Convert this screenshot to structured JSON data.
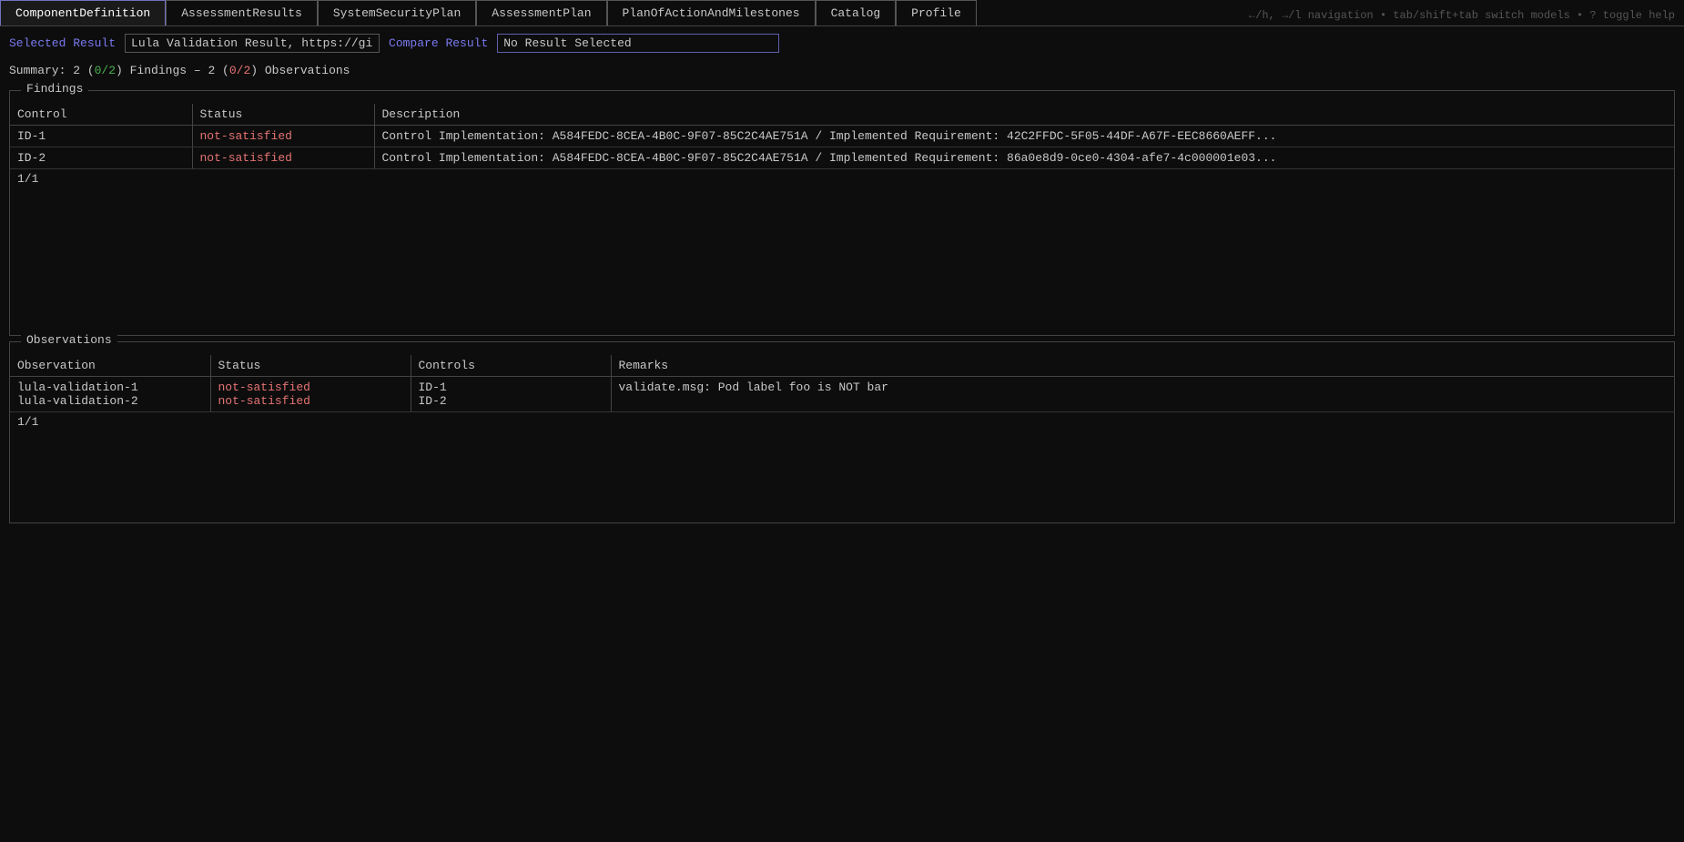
{
  "tabs": [
    {
      "id": "component-definition",
      "label": "ComponentDefinition",
      "active": false
    },
    {
      "id": "assessment-results",
      "label": "AssessmentResults",
      "active": true
    },
    {
      "id": "system-security-plan",
      "label": "SystemSecurityPlan",
      "active": false
    },
    {
      "id": "assessment-plan",
      "label": "AssessmentPlan",
      "active": false
    },
    {
      "id": "plan-of-action-and-milestones",
      "label": "PlanOfActionAndMilestones",
      "active": false
    },
    {
      "id": "catalog",
      "label": "Catalog",
      "active": false
    },
    {
      "id": "profile",
      "label": "Profile",
      "active": false
    }
  ],
  "help_text": "←/h, →/l navigation • tab/shift+tab switch models • ? toggle help",
  "selected_result": {
    "label": "Selected Result",
    "value": "Lula Validation Result, https://github...",
    "placeholder": "Lula Validation Result, https://github..."
  },
  "compare_result": {
    "label": "Compare Result",
    "value": "No Result Selected",
    "placeholder": "No Result Selected"
  },
  "summary": {
    "prefix": "Summary: 2 (",
    "green_part": "0/2",
    "middle": ") Findings – 2 (",
    "red_part": "0/2",
    "suffix": ") Observations"
  },
  "findings": {
    "section_label": "Findings",
    "columns": [
      "Control",
      "Status",
      "Description"
    ],
    "rows": [
      {
        "control": "ID-1",
        "status": "not-satisfied",
        "description": "Control Implementation: A584FEDC-8CEA-4B0C-9F07-85C2C4AE751A / Implemented Requirement: 42C2FFDC-5F05-44DF-A67F-EEC8660AEFF..."
      },
      {
        "control": "ID-2",
        "status": "not-satisfied",
        "description": "Control Implementation: A584FEDC-8CEA-4B0C-9F07-85C2C4AE751A / Implemented Requirement: 86a0e8d9-0ce0-4304-afe7-4c000001e03..."
      }
    ],
    "pagination": "1/1"
  },
  "observations": {
    "section_label": "Observations",
    "columns": [
      "Observation",
      "Status",
      "Controls",
      "Remarks"
    ],
    "rows": [
      {
        "observation": "lula-validation-1",
        "status": "not-satisfied",
        "controls": "ID-1",
        "remarks": "validate.msg: Pod label foo is NOT bar"
      },
      {
        "observation": "lula-validation-2",
        "status": "not-satisfied",
        "controls": "ID-2",
        "remarks": ""
      }
    ],
    "pagination": "1/1"
  }
}
